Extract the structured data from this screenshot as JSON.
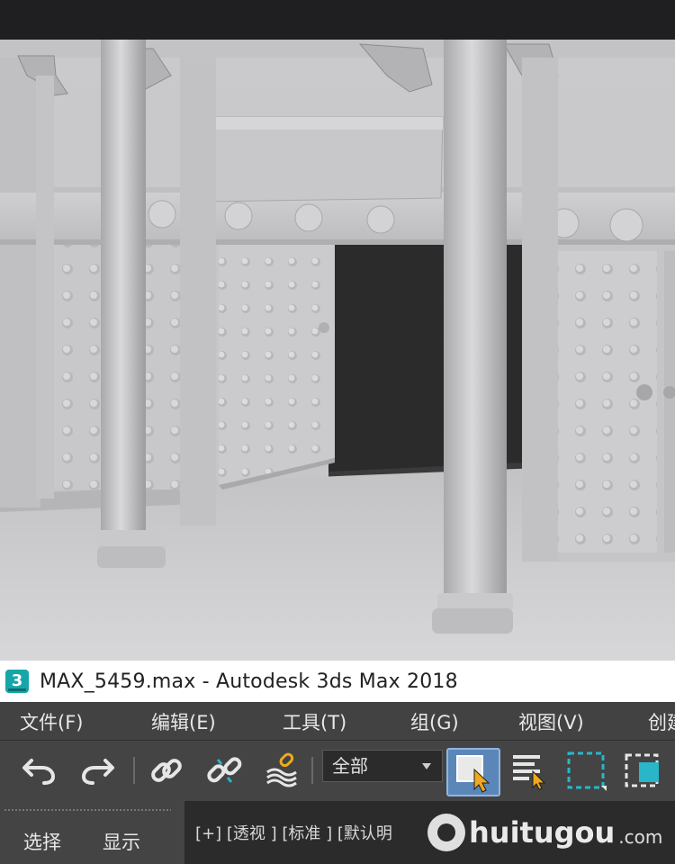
{
  "window": {
    "title": "MAX_5459.max - Autodesk 3ds Max 2018",
    "app_icon": "3ds-max-icon",
    "app_icon_glyph": "3"
  },
  "menu": {
    "items": [
      "文件(F)",
      "编辑(E)",
      "工具(T)",
      "组(G)",
      "视图(V)",
      "创建"
    ]
  },
  "toolbar": {
    "buttons": [
      {
        "icon": "undo-icon"
      },
      {
        "icon": "redo-icon"
      },
      {
        "icon": "link-icon"
      },
      {
        "icon": "unlink-icon"
      },
      {
        "icon": "bind-to-space-warp-icon"
      },
      {
        "icon": "select-object-icon",
        "active": true
      },
      {
        "icon": "select-by-name-icon"
      },
      {
        "icon": "rectangular-selection-region-icon"
      },
      {
        "icon": "window-crossing-icon"
      }
    ],
    "selection_filter": "全部"
  },
  "command_panel": {
    "tabs": [
      "选择",
      "显示"
    ]
  },
  "viewport": {
    "label": "[+] [透视] [标准] [默认明暗处理]",
    "label_visible_text": "[+] [透视 ] [标准 ] [默认明"
  },
  "watermark": {
    "text": "huitugou",
    "tld": ".com"
  },
  "colors": {
    "app_icon": "#17a6a8",
    "active_button": "#5b87b8",
    "select_cursor": "#f0a81c",
    "menu_bg": "#424242",
    "toolbar_bg": "#444444",
    "viewport_label_bg": "#2b2b2b"
  }
}
